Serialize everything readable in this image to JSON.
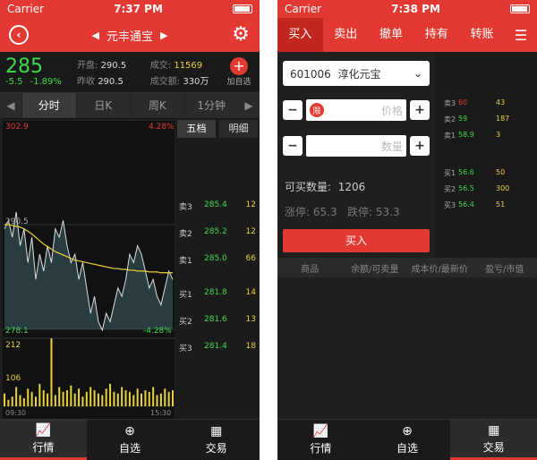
{
  "screen1": {
    "status": {
      "carrier": "Carrier",
      "time": "7:37 PM"
    },
    "nav": {
      "title": "元丰通宝"
    },
    "quote": {
      "price": "285",
      "change": "-5.5",
      "change_pct": "-1.89%",
      "open_label": "开盘:",
      "open": "290.5",
      "prev_label": "昨收",
      "prev": "290.5",
      "volume_label": "成交:",
      "volume": "11569",
      "amount_label": "成交额:",
      "amount": "330万",
      "add_label": "加自选"
    },
    "period_tabs": [
      "分时",
      "日K",
      "周K",
      "1分钟"
    ],
    "chart_labels": {
      "high": "302.9",
      "high_pct": "4.28%",
      "low": "278.1",
      "low_pct": "-4.28%",
      "mid": "290.5",
      "vol_max": "212",
      "vol_mid": "106",
      "t_start": "09:30",
      "t_end": "15:30"
    },
    "book_tabs": [
      "五档",
      "明细"
    ],
    "book": [
      {
        "label": "卖3",
        "price": "285.4",
        "qty": "12"
      },
      {
        "label": "卖2",
        "price": "285.2",
        "qty": "12"
      },
      {
        "label": "卖1",
        "price": "285.0",
        "qty": "66"
      },
      {
        "label": "买1",
        "price": "281.8",
        "qty": "14"
      },
      {
        "label": "买2",
        "price": "281.6",
        "qty": "13"
      },
      {
        "label": "买3",
        "price": "281.4",
        "qty": "18"
      }
    ],
    "tabs": [
      "行情",
      "自选",
      "交易"
    ]
  },
  "chart_data": {
    "type": "line",
    "series": [
      {
        "values": [
          290,
          291,
          289,
          292,
          288,
          290,
          286,
          289,
          284,
          287,
          285,
          288,
          286,
          290,
          289,
          291,
          288,
          286,
          287,
          284,
          286,
          283,
          280,
          282,
          279,
          278,
          280,
          279,
          281,
          283,
          282,
          284,
          287,
          286,
          288,
          287,
          285,
          283,
          284,
          282,
          281,
          283,
          285,
          284
        ]
      },
      {
        "values": [
          290.5,
          290.5,
          290.4,
          290.3,
          290.2,
          290.0,
          289.7,
          289.4,
          289.0,
          288.6,
          288.2,
          287.9,
          287.6,
          287.3,
          287.1,
          286.9,
          286.7,
          286.5,
          286.3,
          286.2,
          286.1,
          286.0,
          285.9,
          285.8,
          285.7,
          285.6,
          285.5,
          285.4,
          285.3,
          285.3,
          285.2,
          285.2,
          285.1,
          285.1,
          285.0,
          285.0,
          285.0,
          284.9,
          284.9,
          284.9,
          284.8,
          284.8,
          284.8,
          284.8
        ]
      }
    ],
    "volume": [
      40,
      20,
      30,
      60,
      35,
      25,
      55,
      45,
      30,
      70,
      50,
      40,
      212,
      35,
      60,
      45,
      50,
      65,
      40,
      55,
      30,
      45,
      60,
      50,
      40,
      35,
      55,
      70,
      45,
      40,
      60,
      50,
      45,
      35,
      55,
      40,
      50,
      45,
      60,
      35,
      40,
      55,
      45,
      50
    ],
    "ylim": [
      278.1,
      302.9
    ],
    "vol_max": 212,
    "xlim": [
      "09:30",
      "15:30"
    ]
  },
  "screen2": {
    "status": {
      "carrier": "Carrier",
      "time": "7:38 PM"
    },
    "nav_tabs": [
      "买入",
      "卖出",
      "撤单",
      "持有",
      "转账"
    ],
    "stock": {
      "code": "601006",
      "name": "淳化元宝"
    },
    "limit_label": "限",
    "price_placeholder": "价格",
    "qty_placeholder": "数量",
    "buyable_label": "可买数量:",
    "buyable": "1206",
    "up_label": "涨停:",
    "up": "65.3",
    "down_label": "跌停:",
    "down": "53.3",
    "buy_button": "买入",
    "book": [
      {
        "label": "卖3",
        "price": "60",
        "qty": "43",
        "color": "#e23a32"
      },
      {
        "label": "卖2",
        "price": "59",
        "qty": "187",
        "color": "#3fd94a"
      },
      {
        "label": "卖1",
        "price": "58.9",
        "qty": "3",
        "color": "#3fd94a"
      },
      {
        "label": "买1",
        "price": "56.6",
        "qty": "50",
        "color": "#3fd94a"
      },
      {
        "label": "买2",
        "price": "56.5",
        "qty": "300",
        "color": "#3fd94a"
      },
      {
        "label": "买3",
        "price": "56.4",
        "qty": "51",
        "color": "#3fd94a"
      }
    ],
    "hold_headers": [
      "商品",
      "余额/可卖量",
      "成本价/最新价",
      "盈亏/市值"
    ],
    "tabs": [
      "行情",
      "自选",
      "交易"
    ]
  }
}
